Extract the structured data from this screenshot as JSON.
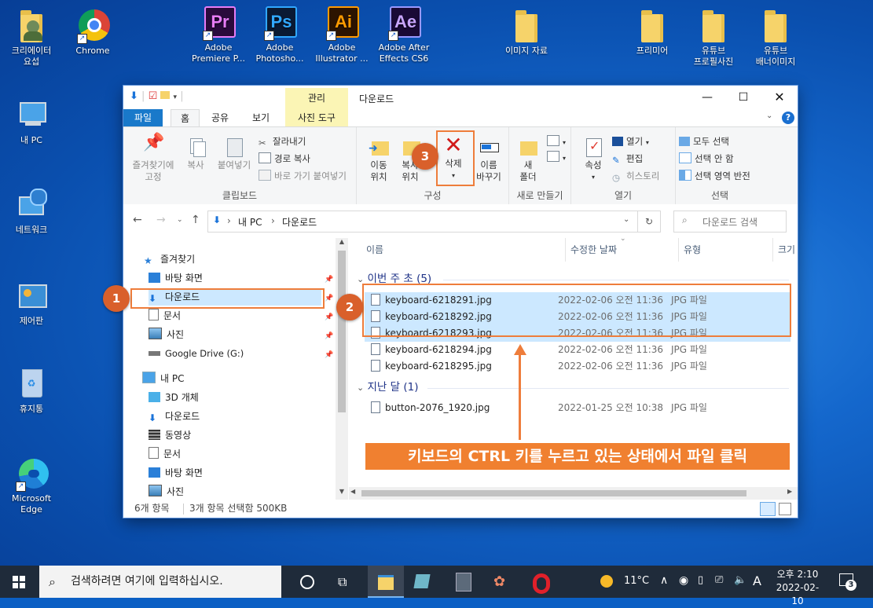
{
  "desktop": {
    "icons": [
      {
        "label": "크리에이터\n요섭",
        "kind": "user-folder"
      },
      {
        "label": "Chrome",
        "kind": "chrome"
      },
      {
        "label": "Adobe\nPremiere P...",
        "kind": "premiere",
        "abbr": "Pr"
      },
      {
        "label": "Adobe\nPhotosho...",
        "kind": "photoshop",
        "abbr": "Ps"
      },
      {
        "label": "Adobe\nIllustrator ...",
        "kind": "illustrator",
        "abbr": "Ai"
      },
      {
        "label": "Adobe After\nEffects CS6",
        "kind": "aftereffects",
        "abbr": "Ae"
      },
      {
        "label": "이미지 자료",
        "kind": "folder"
      },
      {
        "label": "프리미어",
        "kind": "folder"
      },
      {
        "label": "유튜브\n프로필사진",
        "kind": "folder"
      },
      {
        "label": "유튜브\n배너이미지",
        "kind": "folder"
      },
      {
        "label": "내 PC",
        "kind": "pc"
      },
      {
        "label": "네트워크",
        "kind": "network"
      },
      {
        "label": "제어판",
        "kind": "control-panel"
      },
      {
        "label": "휴지통",
        "kind": "recycle-bin"
      },
      {
        "label": "Microsoft\nEdge",
        "kind": "edge"
      }
    ]
  },
  "window": {
    "title": "다운로드",
    "contextual_tab_group": "관리",
    "tabs": [
      "파일",
      "홈",
      "공유",
      "보기",
      "사진 도구"
    ],
    "ribbon": {
      "clipboard": {
        "label": "클립보드",
        "pin": "즐겨찾기에\n고정",
        "copy": "복사",
        "paste": "붙여넣기",
        "cut": "잘라내기",
        "copy_path": "경로 복사",
        "paste_shortcut": "바로 가기 붙여넣기"
      },
      "organize": {
        "label": "구성",
        "move_to": "이동\n위치",
        "copy_to": "복사\n위치",
        "delete": "삭제",
        "rename": "이름\n바꾸기"
      },
      "new": {
        "label": "새로 만들기",
        "new_folder": "새\n폴더"
      },
      "open": {
        "label": "열기",
        "properties": "속성",
        "open": "열기",
        "edit": "편집",
        "history": "히스토리"
      },
      "select": {
        "label": "선택",
        "select_all": "모두 선택",
        "select_none": "선택 안 함",
        "invert": "선택 영역 반전"
      }
    },
    "address": {
      "crumbs": [
        "내 PC",
        "다운로드"
      ],
      "search_placeholder": "다운로드 검색"
    },
    "nav": {
      "quick_access": "즐겨찾기",
      "quick_items": [
        "바탕 화면",
        "다운로드",
        "문서",
        "사진",
        "Google Drive (G:)"
      ],
      "this_pc": "내 PC",
      "pc_items": [
        "3D 개체",
        "다운로드",
        "동영상",
        "문서",
        "바탕 화면",
        "사진"
      ]
    },
    "columns": [
      "이름",
      "수정한 날짜",
      "유형",
      "크기"
    ],
    "groups": [
      {
        "label": "이번 주 초",
        "count": "(5)",
        "files": [
          {
            "name": "keyboard-6218291.jpg",
            "date": "2022-02-06 오전 11:36",
            "type": "JPG 파일",
            "selected": true
          },
          {
            "name": "keyboard-6218292.jpg",
            "date": "2022-02-06 오전 11:36",
            "type": "JPG 파일",
            "selected": true
          },
          {
            "name": "keyboard-6218293.jpg",
            "date": "2022-02-06 오전 11:36",
            "type": "JPG 파일",
            "selected": true
          },
          {
            "name": "keyboard-6218294.jpg",
            "date": "2022-02-06 오전 11:36",
            "type": "JPG 파일",
            "selected": false
          },
          {
            "name": "keyboard-6218295.jpg",
            "date": "2022-02-06 오전 11:36",
            "type": "JPG 파일",
            "selected": false
          }
        ]
      },
      {
        "label": "지난 달",
        "count": "(1)",
        "files": [
          {
            "name": "button-2076_1920.jpg",
            "date": "2022-01-25 오전 10:38",
            "type": "JPG 파일",
            "selected": false
          }
        ]
      }
    ],
    "status": {
      "items": "6개 항목",
      "selection": "3개 항목 선택함 500KB"
    }
  },
  "annotations": {
    "badges": [
      "1",
      "2",
      "3"
    ],
    "callout": "키보드의 CTRL 키를 누르고 있는 상태에서 파일 클릭",
    "color": "#ee7d3b"
  },
  "taskbar": {
    "search_placeholder": "검색하려면 여기에 입력하십시오.",
    "weather": "11°C",
    "ime": "A",
    "time": "오후 2:10",
    "date": "2022-02-10",
    "notifications": "3"
  }
}
